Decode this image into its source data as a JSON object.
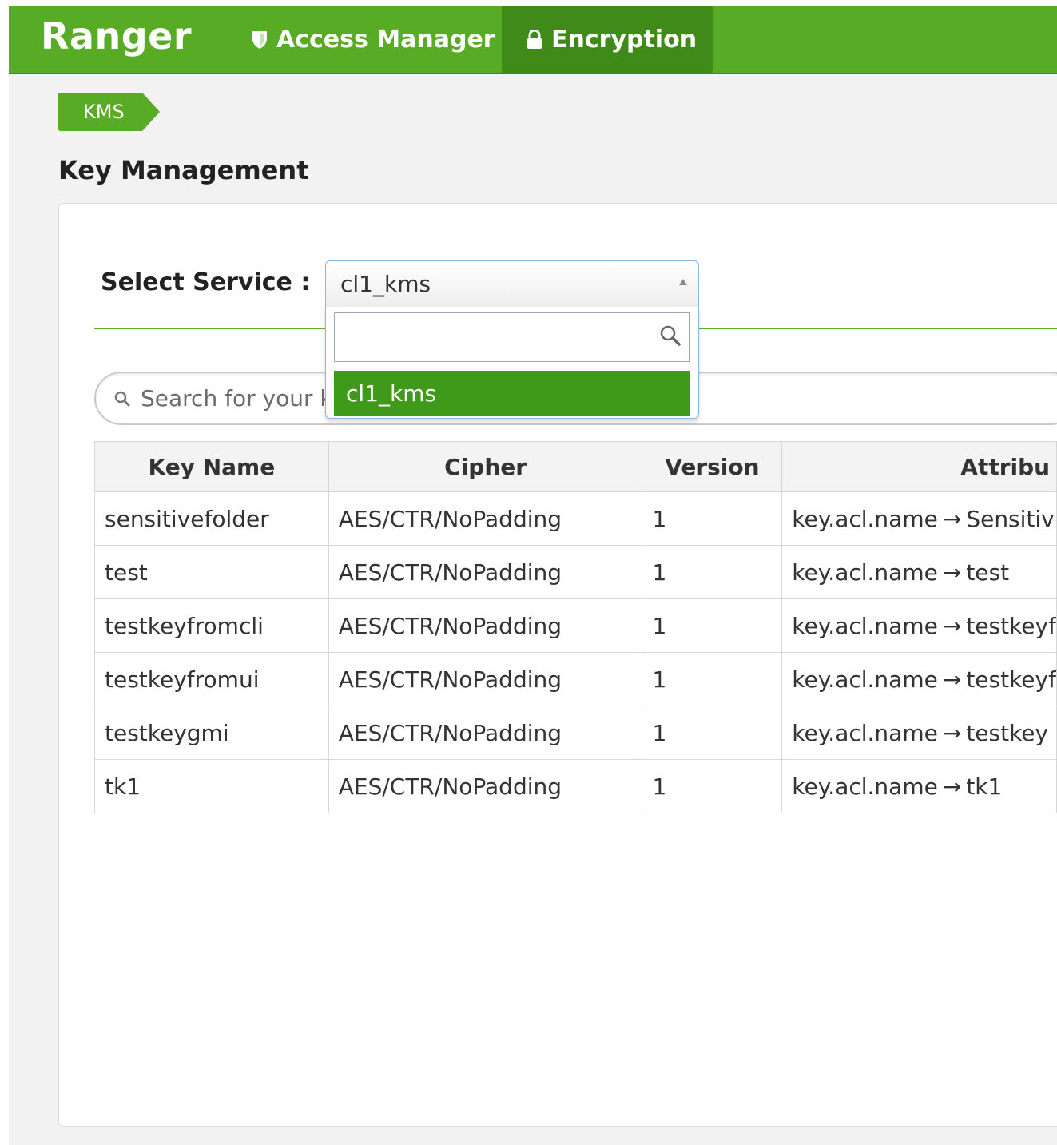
{
  "app": {
    "brand": "Ranger"
  },
  "nav": {
    "access_manager": "Access Manager",
    "encryption": "Encryption"
  },
  "breadcrumb": {
    "kms": "KMS"
  },
  "page": {
    "title": "Key Management"
  },
  "service": {
    "label": "Select Service :",
    "selected": "cl1_kms",
    "dropdown_search_value": "",
    "options": [
      "cl1_kms"
    ]
  },
  "search": {
    "placeholder": "Search for your k"
  },
  "table": {
    "headers": {
      "name": "Key Name",
      "cipher": "Cipher",
      "version": "Version",
      "attributes": "Attribu"
    },
    "arrow": "→",
    "rows": [
      {
        "name": "sensitivefolder",
        "cipher": "AES/CTR/NoPadding",
        "version": "1",
        "attr_key": "key.acl.name",
        "attr_val": "Sensitiv"
      },
      {
        "name": "test",
        "cipher": "AES/CTR/NoPadding",
        "version": "1",
        "attr_key": "key.acl.name",
        "attr_val": "test"
      },
      {
        "name": "testkeyfromcli",
        "cipher": "AES/CTR/NoPadding",
        "version": "1",
        "attr_key": "key.acl.name",
        "attr_val": "testkeyf"
      },
      {
        "name": "testkeyfromui",
        "cipher": "AES/CTR/NoPadding",
        "version": "1",
        "attr_key": "key.acl.name",
        "attr_val": "testkeyf"
      },
      {
        "name": "testkeygmi",
        "cipher": "AES/CTR/NoPadding",
        "version": "1",
        "attr_key": "key.acl.name",
        "attr_val": "testkey"
      },
      {
        "name": "tk1",
        "cipher": "AES/CTR/NoPadding",
        "version": "1",
        "attr_key": "key.acl.name",
        "attr_val": "tk1"
      }
    ]
  },
  "colors": {
    "brand_green": "#58ab24",
    "active_green": "#3f8a18",
    "option_highlight": "#3f9a1a"
  },
  "icons": {
    "access_manager": "shield-icon",
    "encryption": "lock-icon",
    "search": "search-icon"
  }
}
